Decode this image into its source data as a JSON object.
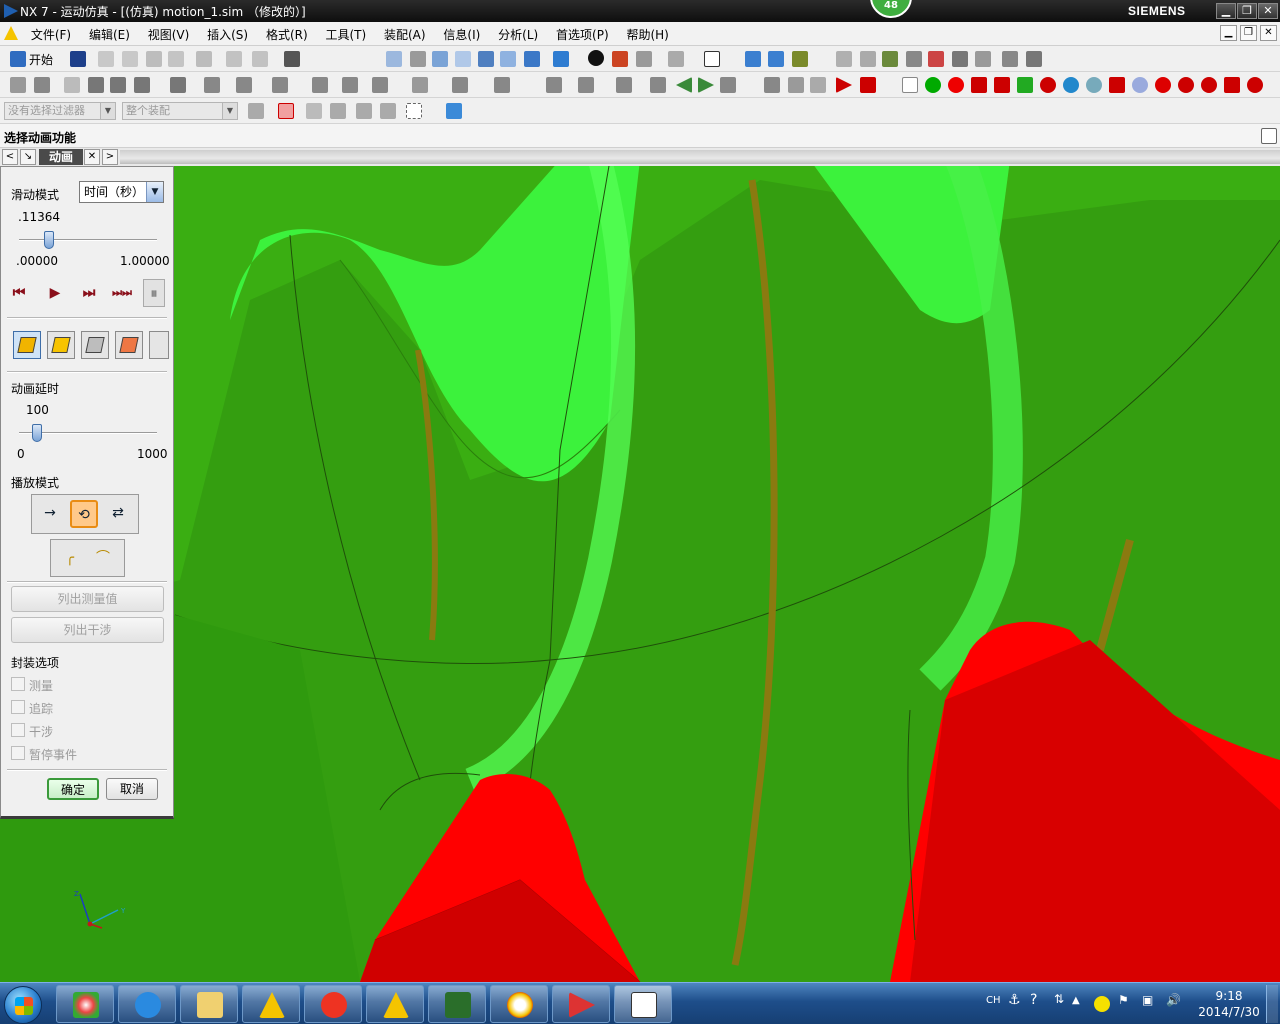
{
  "window": {
    "title": "NX 7 - 运动仿真 - [(仿真) motion_1.sim （修改的）]",
    "brand": "SIEMENS",
    "badge": "48",
    "controls": {
      "minimize": "▁",
      "restore": "❐",
      "close": "✕"
    }
  },
  "menubar": {
    "items": [
      "文件(F)",
      "编辑(E)",
      "视图(V)",
      "插入(S)",
      "格式(R)",
      "工具(T)",
      "装配(A)",
      "信息(I)",
      "分析(L)",
      "首选项(P)",
      "帮助(H)"
    ]
  },
  "toolbar1": {
    "start_label": "开始"
  },
  "toolbar3": {
    "filter_placeholder": "没有选择过滤器",
    "scope_placeholder": "整个装配"
  },
  "cue_line": "选择动画功能",
  "tabstrip": {
    "tab_label": "动画"
  },
  "dialog": {
    "slide_mode_label": "滑动模式",
    "slide_mode_value": "时间（秒）",
    "time_value": ".11364",
    "time_fraction": 0.11364,
    "time_min": ".00000",
    "time_max": "1.00000",
    "playback_buttons": [
      "⏮",
      "▶",
      "⏭",
      "⏭⏭",
      "⏸"
    ],
    "delay_label": "动画延时",
    "delay_value": "100",
    "delay_min": "0",
    "delay_max": "1000",
    "play_mode_label": "播放模式",
    "list_measure": "列出测量值",
    "list_interference": "列出干涉",
    "package_label": "封装选项",
    "checkboxes": [
      "测量",
      "追踪",
      "干涉",
      "暂停事件"
    ],
    "ok": "确定",
    "cancel": "取消"
  },
  "triad": {
    "z": "Z",
    "y": "Y"
  },
  "taskbar": {
    "tray_lang": "CH",
    "time": "9:18",
    "date": "2014/7/30"
  },
  "colors": {
    "gear_green": "#3aae12",
    "gear_dark": "#2d8f0e",
    "gear_light": "#3cf23c",
    "gear_red": "#ff0000",
    "root_brown": "#8a7a10"
  }
}
